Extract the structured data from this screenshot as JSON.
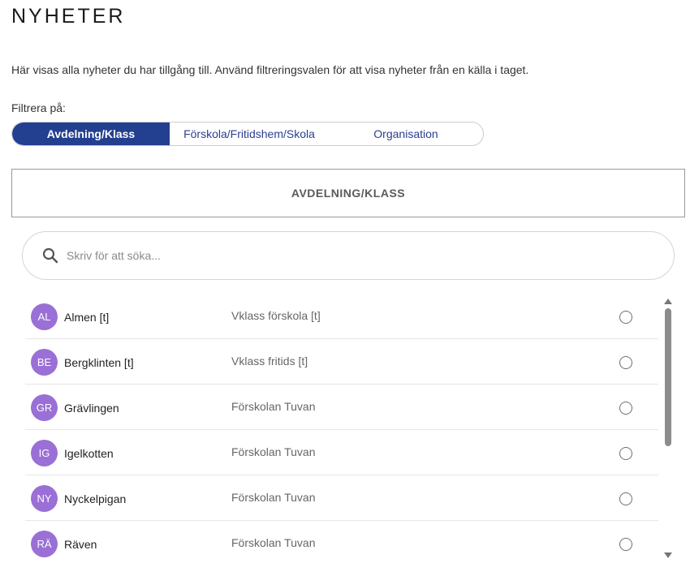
{
  "header": {
    "title": "NYHETER"
  },
  "intro_text": "Här visas alla nyheter du har tillgång till. Använd filtreringsvalen för att visa nyheter från en källa i taget.",
  "filter": {
    "label": "Filtrera på:",
    "options": [
      {
        "label": "Avdelning/Klass",
        "active": true
      },
      {
        "label": "Förskola/Fritidshem/Skola",
        "active": false
      },
      {
        "label": "Organisation",
        "active": false
      }
    ]
  },
  "section": {
    "heading": "AVDELNING/KLASS"
  },
  "search": {
    "placeholder": "Skriv för att söka...",
    "icon": "search-icon"
  },
  "items": [
    {
      "initials": "AL",
      "name": "Almen [t]",
      "school": "Vklass förskola [t]",
      "selected": false
    },
    {
      "initials": "BE",
      "name": "Bergklinten [t]",
      "school": "Vklass fritids [t]",
      "selected": false
    },
    {
      "initials": "GR",
      "name": "Grävlingen",
      "school": "Förskolan Tuvan",
      "selected": false
    },
    {
      "initials": "IG",
      "name": "Igelkotten",
      "school": "Förskolan Tuvan",
      "selected": false
    },
    {
      "initials": "NY",
      "name": "Nyckelpigan",
      "school": "Förskolan Tuvan",
      "selected": false
    },
    {
      "initials": "RÄ",
      "name": "Räven",
      "school": "Förskolan Tuvan",
      "selected": false
    }
  ],
  "colors": {
    "accent": "#233f8f",
    "avatar": "#9a6fd6"
  }
}
